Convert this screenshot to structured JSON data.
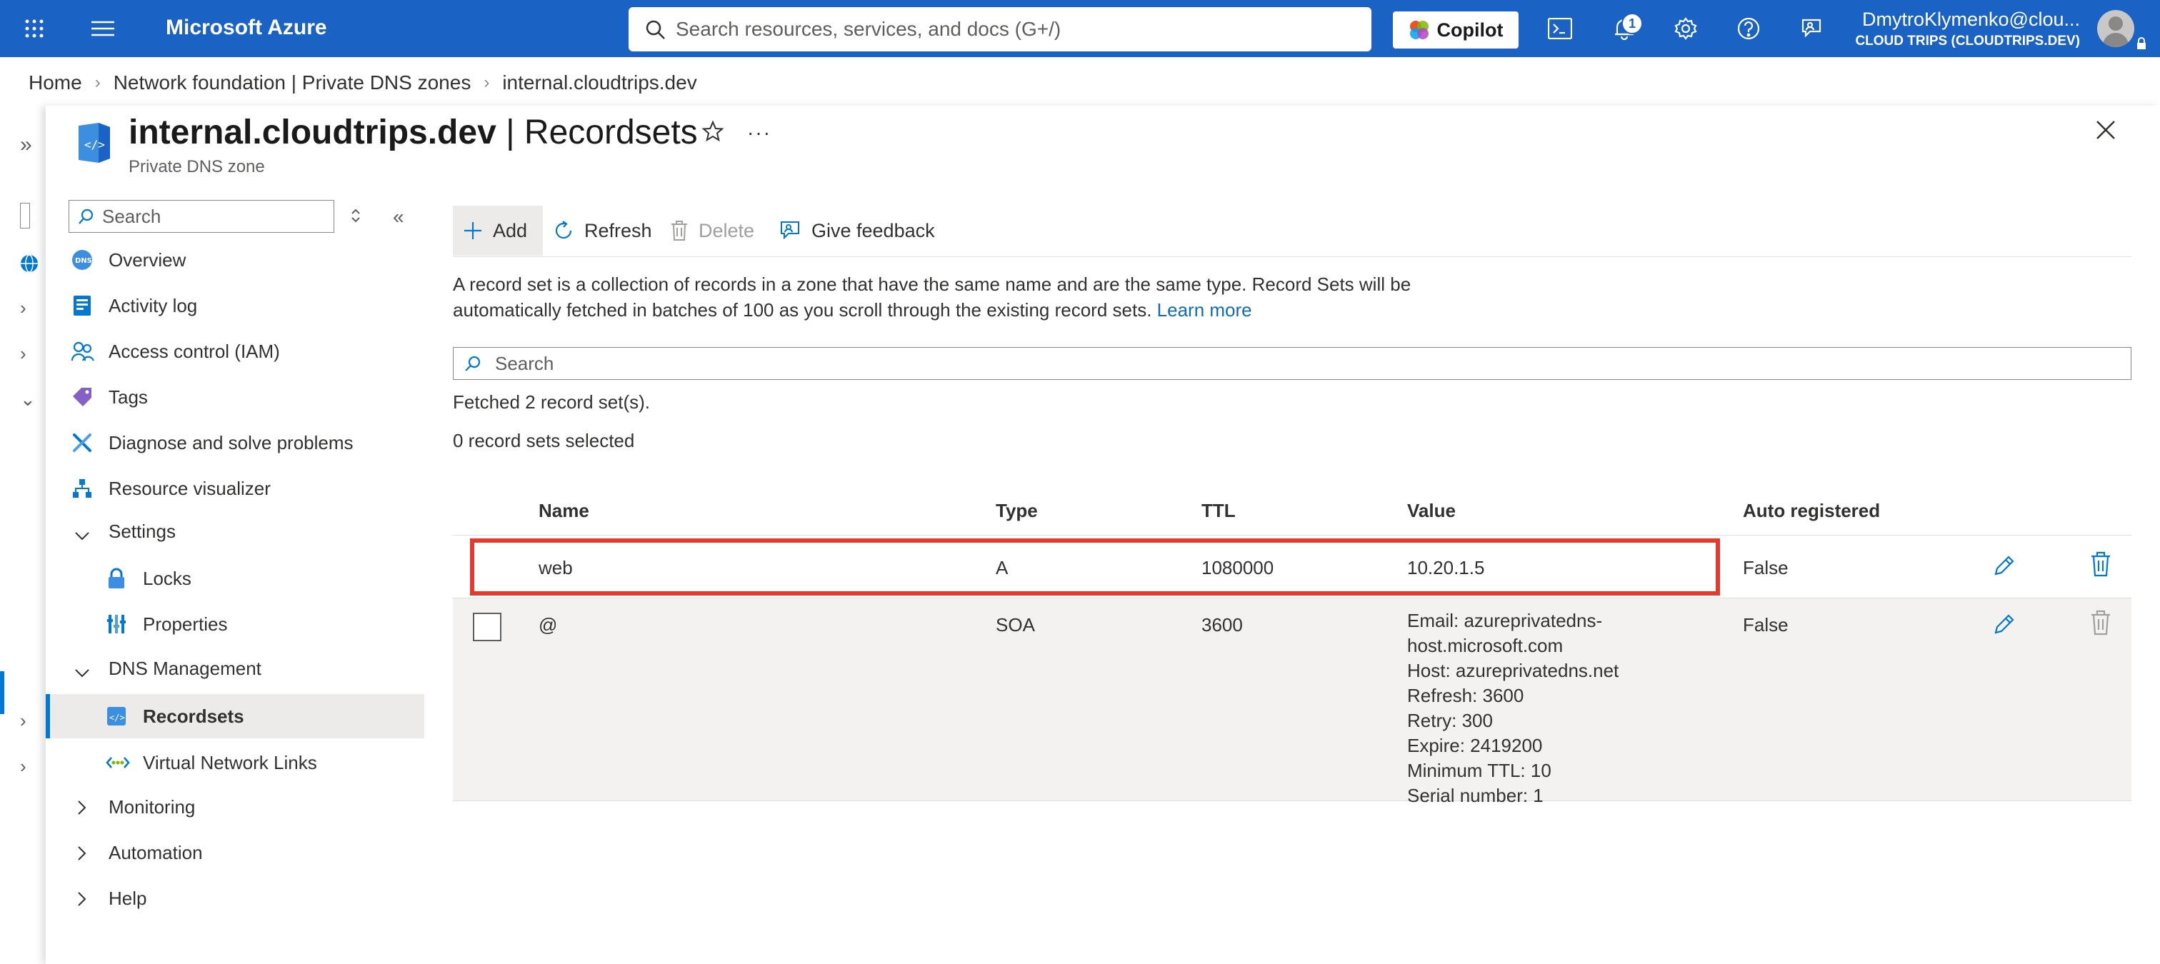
{
  "topbar": {
    "brand": "Microsoft Azure",
    "search_placeholder": "Search resources, services, and docs (G+/)",
    "copilot_label": "Copilot",
    "notification_count": "1",
    "account_name": "DmytroKlymenko@clou...",
    "account_tenant": "CLOUD TRIPS (CLOUDTRIPS.DEV)",
    "icons": [
      "waffle-icon",
      "hamburger-icon",
      "search-icon",
      "copilot-icon",
      "cloud-shell-icon",
      "bell-icon",
      "gear-icon",
      "help-icon",
      "feedback-icon",
      "avatar",
      "lock-icon"
    ]
  },
  "breadcrumb": {
    "items": [
      "Home",
      "Network foundation | Private DNS zones",
      "internal.cloudtrips.dev"
    ]
  },
  "blade": {
    "title_bold": "internal.cloudtrips.dev",
    "title_rest": " | Recordsets",
    "subtitle": "Private DNS zone"
  },
  "menu": {
    "search_placeholder": "Search",
    "items": [
      {
        "label": "Overview",
        "icon": "dns-icon"
      },
      {
        "label": "Activity log",
        "icon": "activity-log-icon"
      },
      {
        "label": "Access control (IAM)",
        "icon": "iam-icon"
      },
      {
        "label": "Tags",
        "icon": "tag-icon"
      },
      {
        "label": "Diagnose and solve problems",
        "icon": "wrench-icon"
      },
      {
        "label": "Resource visualizer",
        "icon": "visualizer-icon"
      },
      {
        "label": "Settings",
        "icon": "chevron-down-icon"
      },
      {
        "label": "Locks",
        "icon": "lock-icon"
      },
      {
        "label": "Properties",
        "icon": "properties-icon"
      },
      {
        "label": "DNS Management",
        "icon": "chevron-down-icon"
      },
      {
        "label": "Recordsets",
        "icon": "recordset-icon"
      },
      {
        "label": "Virtual Network Links",
        "icon": "vnet-link-icon"
      },
      {
        "label": "Monitoring",
        "icon": "chevron-right-icon"
      },
      {
        "label": "Automation",
        "icon": "chevron-right-icon"
      },
      {
        "label": "Help",
        "icon": "chevron-right-icon"
      }
    ]
  },
  "commands": {
    "add": "Add",
    "refresh": "Refresh",
    "delete": "Delete",
    "feedback": "Give feedback"
  },
  "description": {
    "text": "A record set is a collection of records in a zone that have the same name and are the same type. Record Sets will be automatically fetched in batches of 100 as you scroll through the existing record sets.",
    "link": "Learn more"
  },
  "recordsets": {
    "search_placeholder": "Search",
    "fetched_text": "Fetched 2 record set(s).",
    "selected_text": "0 record sets selected",
    "columns": [
      "Name",
      "Type",
      "TTL",
      "Value",
      "Auto registered"
    ],
    "rows": [
      {
        "name": "web",
        "type": "A",
        "ttl": "1080000",
        "value": [
          "10.20.1.5"
        ],
        "auto": "False"
      },
      {
        "name": "@",
        "type": "SOA",
        "ttl": "3600",
        "value": [
          "Email: azureprivatedns-",
          "host.microsoft.com",
          "Host: azureprivatedns.net",
          "Refresh: 3600",
          "Retry: 300",
          "Expire: 2419200",
          "Minimum TTL: 10",
          "Serial number: 1"
        ],
        "auto": "False"
      }
    ]
  },
  "colors": {
    "topbar": "#1a62c4",
    "accent": "#0078d4",
    "highlight": "#e23a2e"
  }
}
